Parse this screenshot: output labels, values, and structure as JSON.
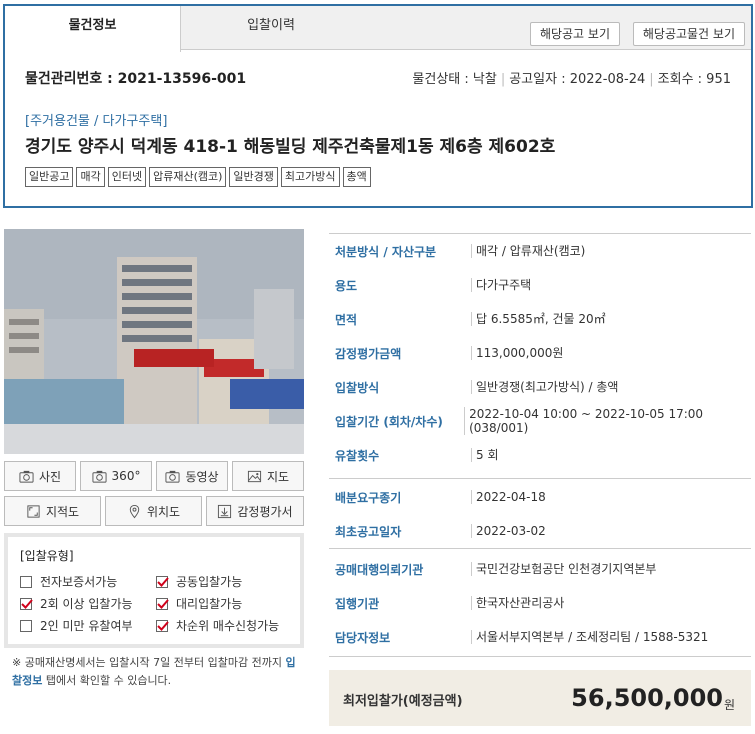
{
  "tabs": {
    "active": "물건정보",
    "other": "입찰이력"
  },
  "buttons": {
    "notice": "해당공고 보기",
    "notice_items": "해당공고물건 보기"
  },
  "management": "물건관리번호 : 2021-13596-001",
  "status": {
    "state": "물건상태 : 낙찰",
    "notice_date": "공고일자 : 2022-08-24",
    "views": "조회수 : 951"
  },
  "category": "[주거용건물 / 다가구주택]",
  "title": "경기도 양주시 덕계동 418-1 해동빌딩 제주건축물제1동 제6층 제602호",
  "badges": [
    "일반공고",
    "매각",
    "인터넷",
    "압류재산(캠코)",
    "일반경쟁",
    "최고가방식",
    "총액"
  ],
  "media": {
    "photo": "사진",
    "view360": "360°",
    "video": "동영상",
    "map": "지도",
    "cadastral": "지적도",
    "location": "위치도",
    "appraisal": "감정평가서"
  },
  "bid_type": {
    "header": "[입찰유형]",
    "items": [
      {
        "label": "전자보증서가능",
        "checked": false
      },
      {
        "label": "공동입찰가능",
        "checked": true
      },
      {
        "label": "2회 이상 입찰가능",
        "checked": true
      },
      {
        "label": "대리입찰가능",
        "checked": true
      },
      {
        "label": "2인 미만 유찰여부",
        "checked": false
      },
      {
        "label": "차순위 매수신청가능",
        "checked": true
      }
    ]
  },
  "note": {
    "pre": "※ 공매재산명세서는 입찰시작 7일 전부터 입찰마감 전까지 ",
    "link": "입찰정보",
    "post": " 탭에서 확인할 수 있습니다."
  },
  "info": [
    {
      "k": "처분방식 / 자산구분",
      "v": "매각 / 압류재산(캠코)"
    },
    {
      "k": "용도",
      "v": "다가구주택"
    },
    {
      "k": "면적",
      "v": "답 6.5585㎡, 건물 20㎡"
    },
    {
      "k": "감정평가금액",
      "v": "113,000,000원"
    },
    {
      "k": "입찰방식",
      "v": "일반경쟁(최고가방식) / 총액"
    },
    {
      "k": "입찰기간 (회차/차수)",
      "v": "2022-10-04 10:00 ~ 2022-10-05 17:00 (038/001)"
    },
    {
      "k": "유찰횟수",
      "v": "5 회"
    },
    {
      "k": "배분요구종기",
      "v": "2022-04-18"
    },
    {
      "k": "최초공고일자",
      "v": "2022-03-02"
    },
    {
      "k": "공매대행의뢰기관",
      "v": "국민건강보험공단 인천경기지역본부"
    },
    {
      "k": "집행기관",
      "v": "한국자산관리공사"
    },
    {
      "k": "담당자정보",
      "v": "서울서부지역본부 / 조세정리팀 / 1588-5321"
    }
  ],
  "price": {
    "label": "최저입찰가(예정금액)",
    "amount": "56,500,000",
    "unit": "원"
  },
  "colors": {
    "accent": "#2f6fa3",
    "check": "#d0021b",
    "price_bg": "#f1ede4"
  }
}
